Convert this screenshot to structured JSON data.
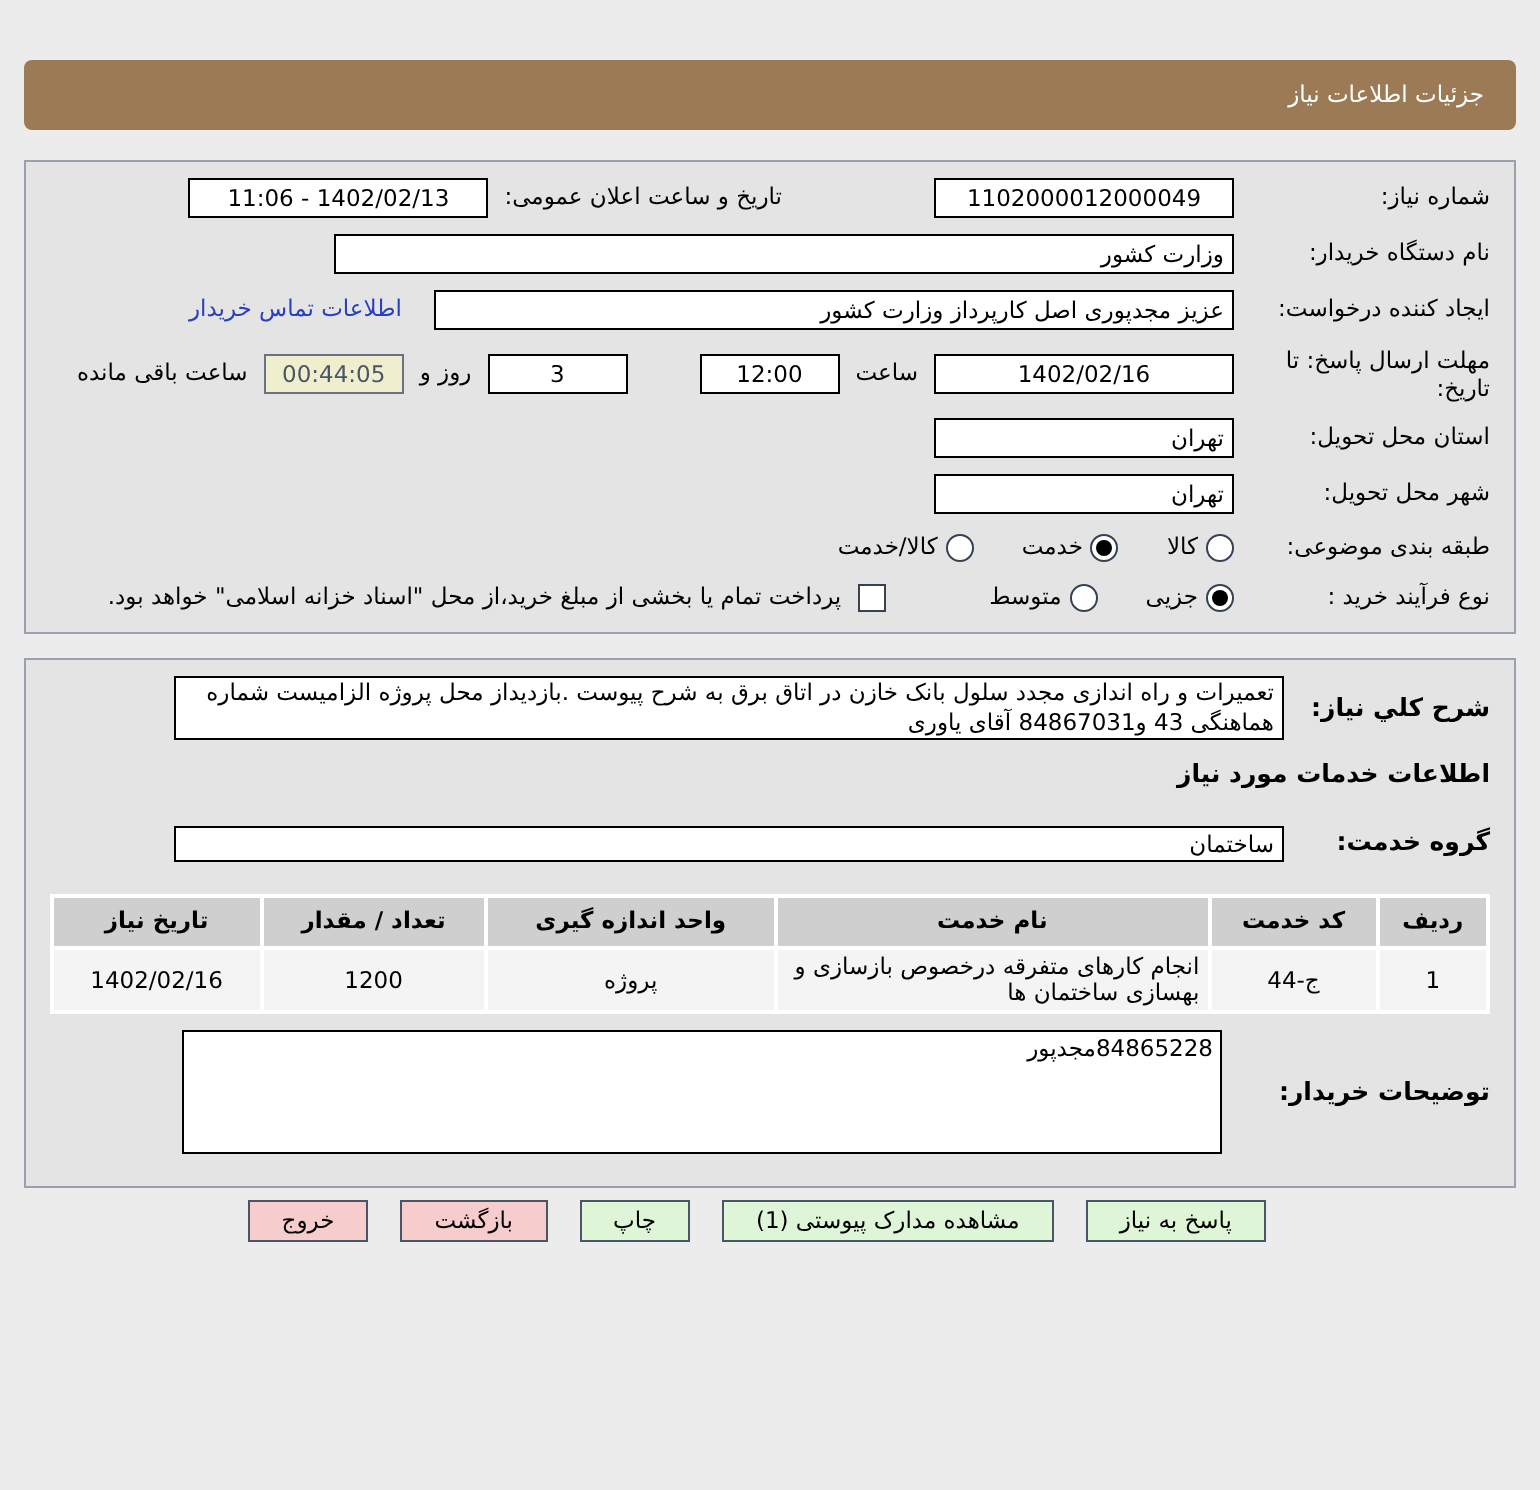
{
  "header": {
    "title": "جزئیات اطلاعات نیاز"
  },
  "need_number": {
    "label": "شماره نیاز:",
    "value": "1102000012000049"
  },
  "announce": {
    "label": "تاریخ و ساعت اعلان عمومی:",
    "value": "1402/02/13 - 11:06"
  },
  "buyer_org": {
    "label": "نام دستگاه خریدار:",
    "value": "وزارت کشور"
  },
  "requester": {
    "label": "ایجاد کننده درخواست:",
    "value": "عزیز مجدپوری اصل کارپرداز وزارت کشور",
    "link": "اطلاعات تماس خریدار"
  },
  "deadline": {
    "label": "مهلت ارسال پاسخ: تا تاریخ:",
    "date": "1402/02/16",
    "time_label": "ساعت",
    "time": "12:00",
    "days": "3",
    "days_label": "روز و",
    "remaining": "00:44:05",
    "remaining_label": "ساعت باقی مانده"
  },
  "province": {
    "label": "استان محل تحویل:",
    "value": "تهران"
  },
  "city": {
    "label": "شهر محل تحویل:",
    "value": "تهران"
  },
  "category": {
    "label": "طبقه بندی موضوعی:",
    "options": [
      {
        "label": "کالا",
        "selected": false
      },
      {
        "label": "خدمت",
        "selected": true
      },
      {
        "label": "کالا/خدمت",
        "selected": false
      }
    ]
  },
  "purchase_type": {
    "label": "نوع فرآیند خرید :",
    "options": [
      {
        "label": "جزیی",
        "selected": true
      },
      {
        "label": "متوسط",
        "selected": false
      }
    ],
    "payment": {
      "checked": false,
      "label": "پرداخت تمام یا بخشی از مبلغ خرید،از محل \"اسناد خزانه اسلامی\" خواهد بود."
    }
  },
  "description": {
    "label": "شرح کلي نیاز:",
    "value": "تعمیرات و راه اندازی مجدد سلول بانک خازن در اتاق برق به شرح پیوست .بازدیداز محل پروژه الزامیست شماره هماهنگی 43 و84867031 آقای یاوری"
  },
  "services_title": "اطلاعات خدمات مورد نیاز",
  "service_group": {
    "label": "گروه خدمت:",
    "value": "ساختمان"
  },
  "table": {
    "columns": [
      "ردیف",
      "کد خدمت",
      "نام خدمت",
      "واحد اندازه گیری",
      "تعداد / مقدار",
      "تاریخ نیاز"
    ],
    "rows": [
      [
        "1",
        "ج-44",
        "انجام کارهای متفرقه درخصوص بازسازی و بهسازی ساختمان ها",
        "پروژه",
        "1200",
        "1402/02/16"
      ]
    ]
  },
  "buyer_notes": {
    "label": "توضیحات خریدار:",
    "value": "84865228مجدپور"
  },
  "buttons": [
    {
      "label": "پاسخ به نیاز",
      "kind": "green"
    },
    {
      "label": "مشاهده مدارک پیوستی (1)",
      "kind": "green"
    },
    {
      "label": "چاپ",
      "kind": "green"
    },
    {
      "label": "بازگشت",
      "kind": "red"
    },
    {
      "label": "خروج",
      "kind": "red"
    }
  ]
}
